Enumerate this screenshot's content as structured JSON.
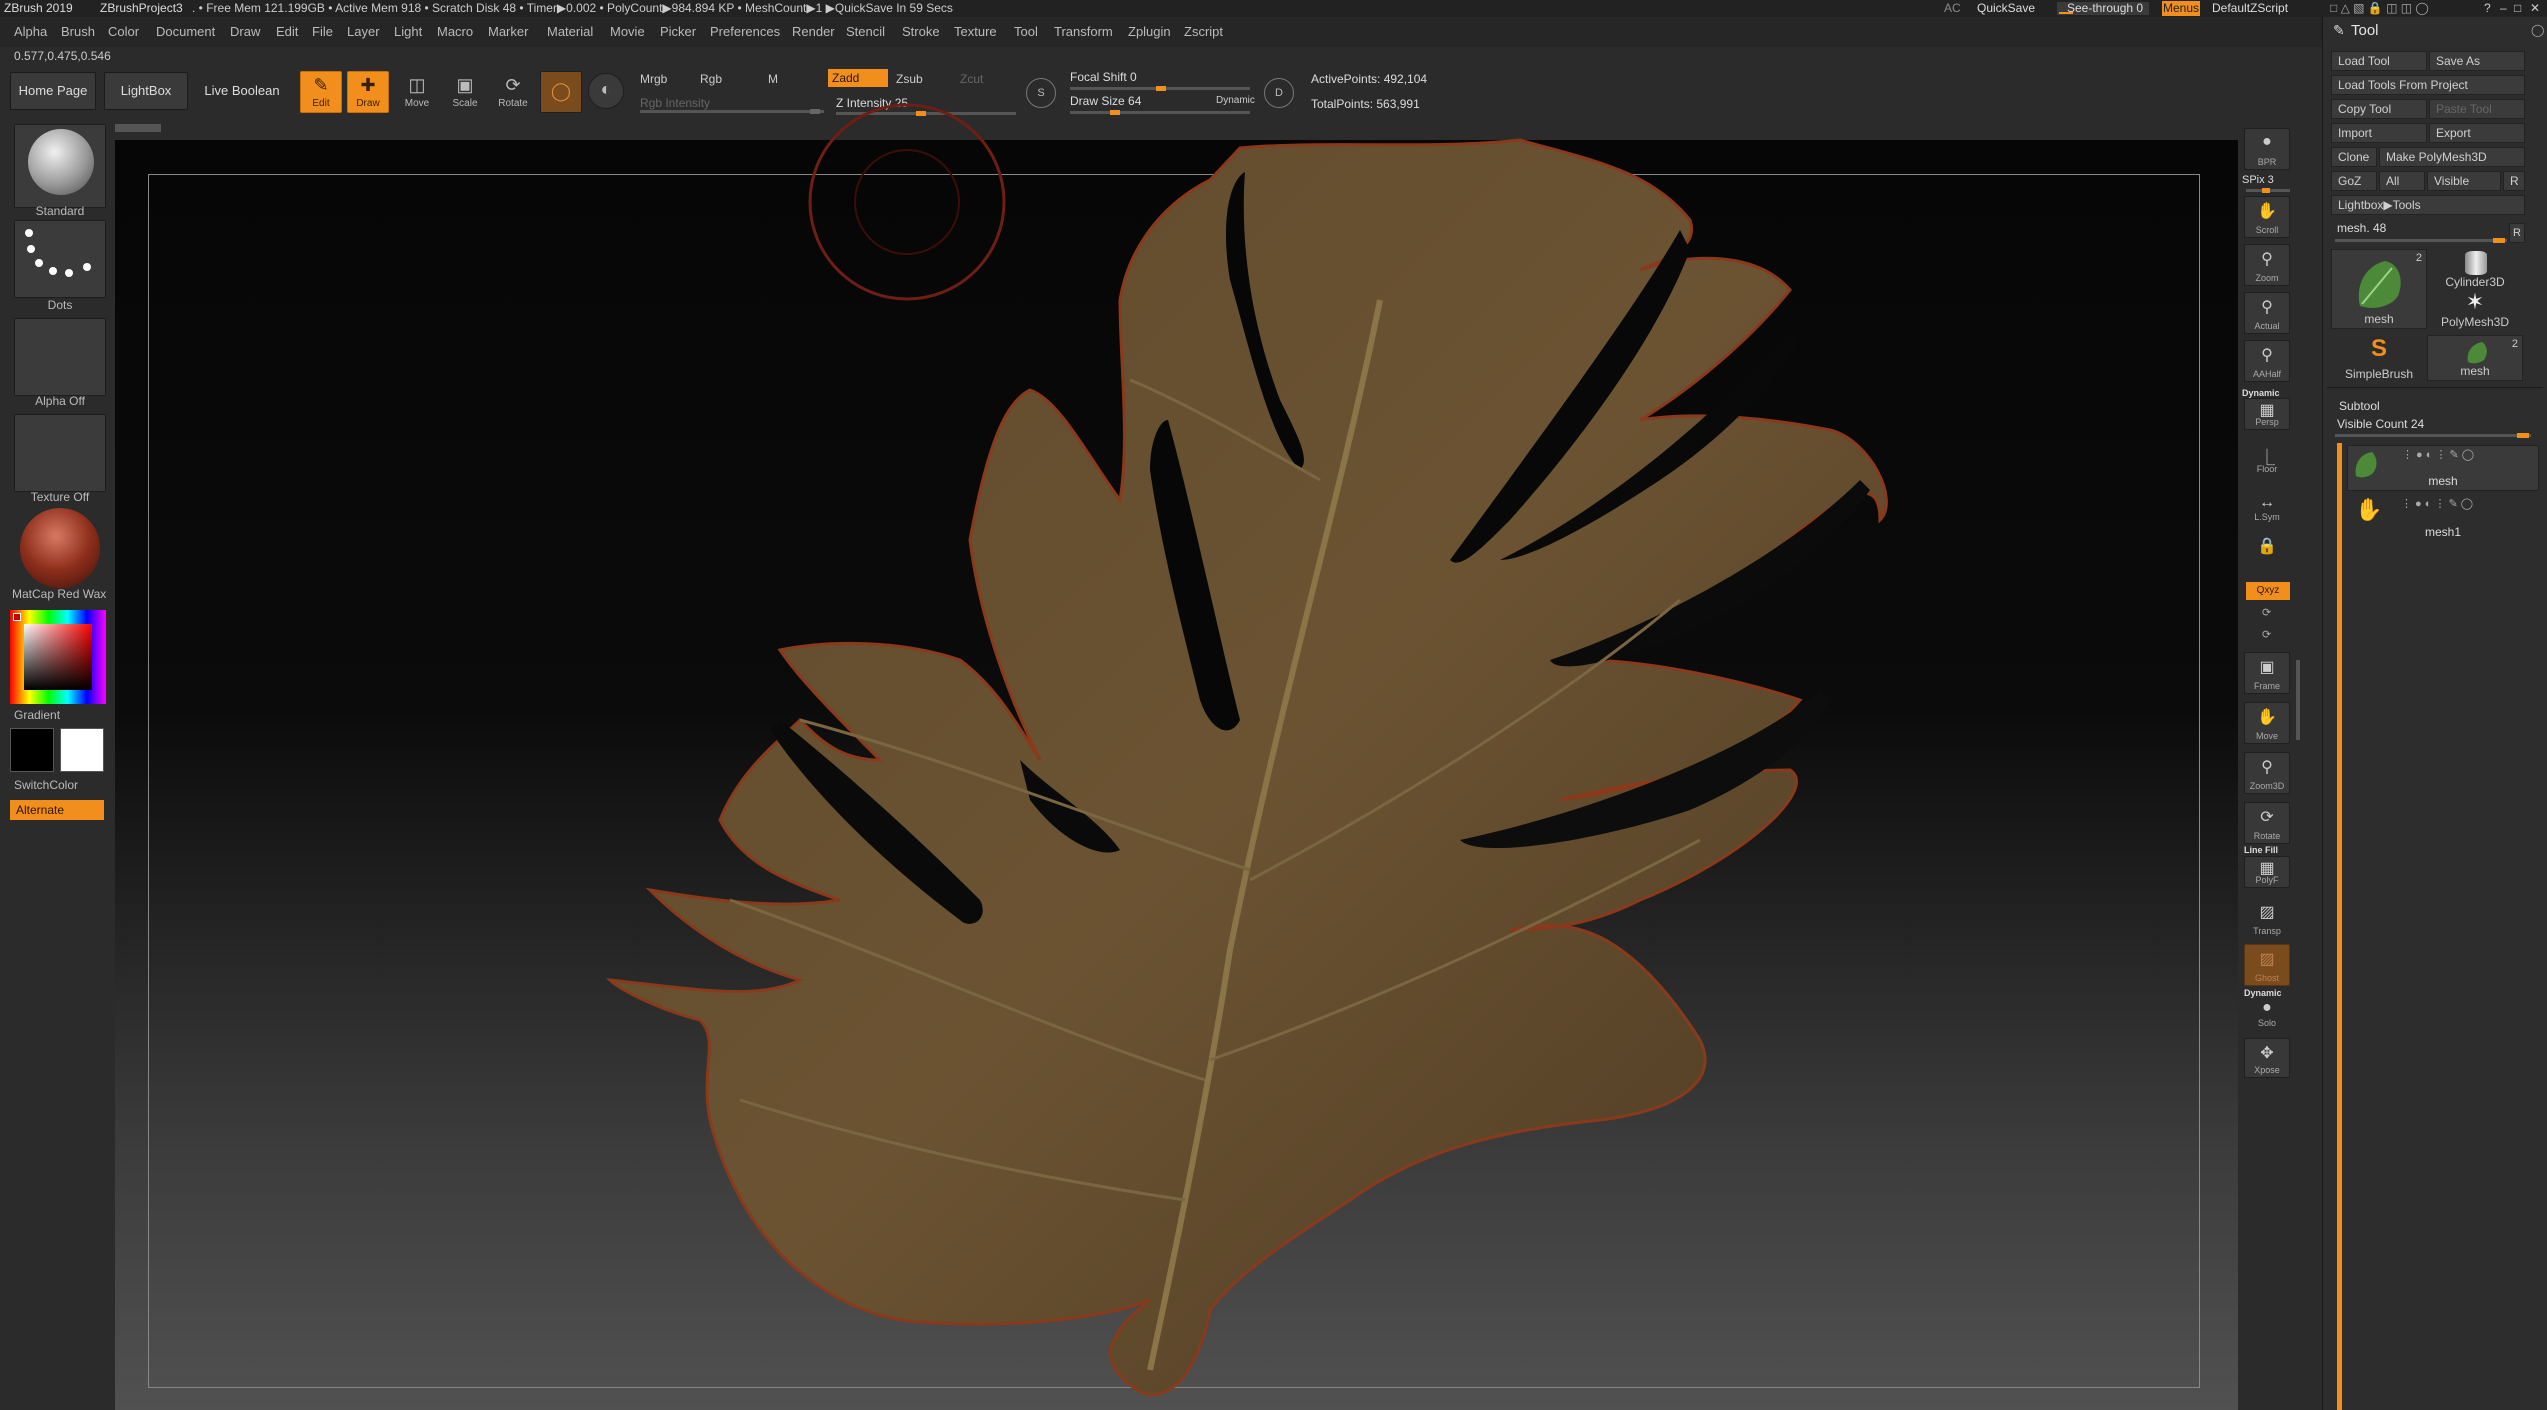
{
  "titlebar": {
    "app": "ZBrush 2019",
    "project": "ZBrushProject3",
    "stats": ". • Free Mem 121.199GB • Active Mem 918 • Scratch Disk 48 •  Timer▶0.002 • PolyCount▶984.894 KP • MeshCount▶1  ▶QuickSave In 59 Secs",
    "ac": "AC",
    "quicksave": "QuickSave",
    "see_through": "See-through  0",
    "menus": "Menus",
    "script": "DefaultZScript"
  },
  "menu": [
    "Alpha",
    "Brush",
    "Color",
    "Document",
    "Draw",
    "Edit",
    "File",
    "Layer",
    "Light",
    "Macro",
    "Marker",
    "Material",
    "Movie",
    "Picker",
    "Preferences",
    "Render",
    "Stencil",
    "Stroke",
    "Texture",
    "Tool",
    "Transform",
    "Zplugin",
    "Zscript"
  ],
  "coords": "0.577,0.475,0.546",
  "shelf": {
    "home": "Home Page",
    "lightbox": "LightBox",
    "live_boolean": "Live Boolean",
    "edit": "Edit",
    "draw": "Draw",
    "move": "Move",
    "scale": "Scale",
    "rotate": "Rotate",
    "mrgb": "Mrgb",
    "rgb": "Rgb",
    "m": "M",
    "rgb_intensity": "Rgb Intensity",
    "zadd": "Zadd",
    "zsub": "Zsub",
    "zcut": "Zcut",
    "z_intensity": "Z Intensity 25",
    "focal_shift": "Focal Shift 0",
    "draw_size": "Draw Size 64",
    "dynamic": "Dynamic",
    "active_points": "ActivePoints: 492,104",
    "total_points": "TotalPoints: 563,991",
    "s_label": "S",
    "d_label": "D"
  },
  "left": {
    "standard": "Standard",
    "dots": "Dots",
    "alpha_off": "Alpha Off",
    "texture_off": "Texture Off",
    "material": "MatCap Red Wax",
    "gradient": "Gradient",
    "switch_color": "SwitchColor",
    "alternate": "Alternate"
  },
  "right_shelf": {
    "bpr": "BPR",
    "spix": "SPix 3",
    "scroll": "Scroll",
    "zoom": "Zoom",
    "actual": "Actual",
    "aahalf": "AAHalf",
    "dynamic": "Dynamic",
    "persp": "Persp",
    "floor": "Floor",
    "lsym": "L.Sym",
    "xyz": "Qxyz",
    "frame": "Frame",
    "move": "Move",
    "zoom3d": "Zoom3D",
    "rotate": "Rotate",
    "line_fill": "Line Fill",
    "polyf": "PolyF",
    "transp": "Transp",
    "ghost": "Ghost",
    "dynamic2": "Dynamic",
    "solo": "Solo",
    "xpose": "Xpose"
  },
  "tool": {
    "title": "Tool",
    "load_tool": "Load Tool",
    "save_as": "Save As",
    "load_from_project": "Load Tools From Project",
    "copy_tool": "Copy Tool",
    "paste_tool": "Paste Tool",
    "import": "Import",
    "export": "Export",
    "clone": "Clone",
    "make_polymesh": "Make PolyMesh3D",
    "goz": "GoZ",
    "all": "All",
    "visible": "Visible",
    "r": "R",
    "lightbox_tools": "Lightbox▶Tools",
    "mesh_slider": "mesh. 48",
    "thumbs": [
      {
        "name": "mesh",
        "badge": "2"
      },
      {
        "name": "Cylinder3D",
        "badge": ""
      },
      {
        "name": "PolyMesh3D",
        "badge": ""
      },
      {
        "name": "SimpleBrush",
        "badge": ""
      },
      {
        "name": "mesh",
        "badge": "2"
      }
    ],
    "subtool": "Subtool",
    "visible_count": "Visible Count 24",
    "subtools": [
      "mesh",
      "mesh1"
    ]
  },
  "colors": {
    "accent": "#f28e1c",
    "leaf": "#6b5332"
  }
}
